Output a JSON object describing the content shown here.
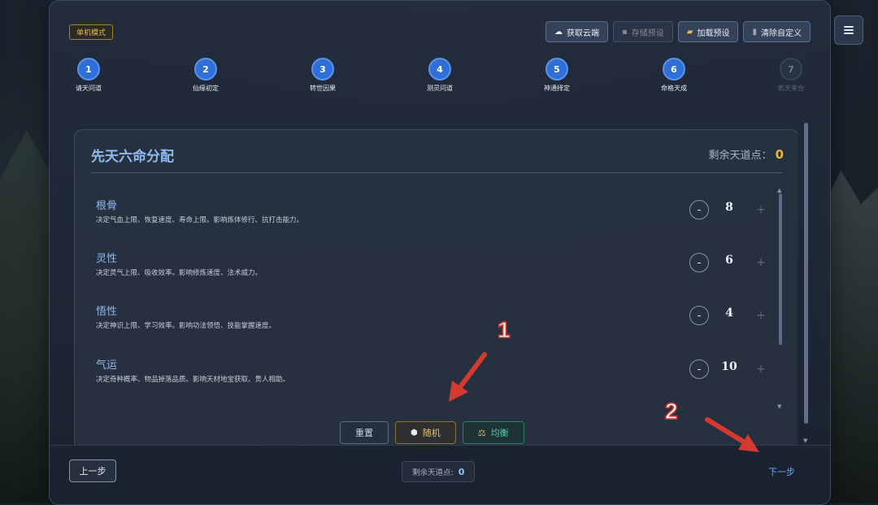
{
  "mode_badge": "单机模式",
  "top_actions": [
    {
      "label": "获取云端",
      "icon": "cloud-icon",
      "glyph": "☁",
      "disabled": false
    },
    {
      "label": "存储预设",
      "icon": "save-icon",
      "glyph": "▪",
      "disabled": true
    },
    {
      "label": "加载预设",
      "icon": "folder-icon",
      "glyph": "▰",
      "disabled": false
    },
    {
      "label": "清除自定义",
      "icon": "trash-icon",
      "glyph": "▮",
      "disabled": false
    }
  ],
  "steps": [
    {
      "num": "1",
      "label": "请天问道",
      "active": true
    },
    {
      "num": "2",
      "label": "仙缘初定",
      "active": true
    },
    {
      "num": "3",
      "label": "转世因果",
      "active": true
    },
    {
      "num": "4",
      "label": "测灵问道",
      "active": true
    },
    {
      "num": "5",
      "label": "神通择定",
      "active": true
    },
    {
      "num": "6",
      "label": "命格天成",
      "active": true
    },
    {
      "num": "7",
      "label": "乾天来合",
      "active": false
    }
  ],
  "card": {
    "title": "先天六命分配",
    "remain_label": "剩余天道点：",
    "remain_value": "0"
  },
  "attributes": [
    {
      "name": "根骨",
      "desc": "决定气血上限、恢复速度、寿命上限。影响炼体修行、抗打击能力。",
      "value": "8",
      "minus": "-",
      "plus": "+"
    },
    {
      "name": "灵性",
      "desc": "决定灵气上限、吸收效率。影响修炼速度、法术威力。",
      "value": "6",
      "minus": "-",
      "plus": "+"
    },
    {
      "name": "悟性",
      "desc": "决定神识上限、学习效率。影响功法领悟、技能掌握速度。",
      "value": "4",
      "minus": "-",
      "plus": "+"
    },
    {
      "name": "气运",
      "desc": "决定奇种概率、物品掉落品质。影响天材地宝获取、贵人相助。",
      "value": "10",
      "minus": "-",
      "plus": "+"
    }
  ],
  "action_buttons": {
    "reset": "重置",
    "random": "随机",
    "random_icon": "dice-icon",
    "random_glyph": "⬢",
    "balance": "均衡",
    "balance_icon": "scale-icon",
    "balance_glyph": "⚖"
  },
  "footer": {
    "prev": "上一步",
    "remain_label": "剩余天道点:",
    "remain_value": "0",
    "next": "下一步"
  },
  "annotations": [
    {
      "label": "1",
      "color": "#d43a2f"
    },
    {
      "label": "2",
      "color": "#d43a2f"
    }
  ]
}
